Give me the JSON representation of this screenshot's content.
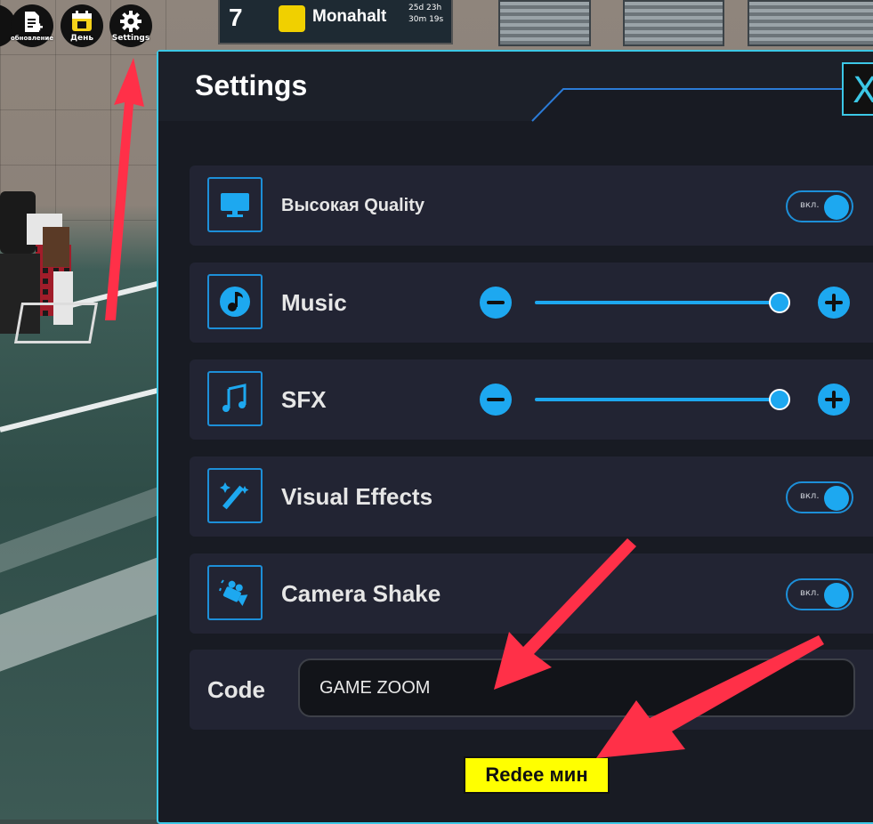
{
  "colors": {
    "accent": "#1da8f0",
    "panel_bg": "#181b23",
    "row_bg": "#222433",
    "redeem_bg": "#ffff00",
    "arrow": "#ff3048"
  },
  "top_buttons": [
    {
      "label": "обновление",
      "icon": "document-plus-icon"
    },
    {
      "label": "День",
      "icon": "calendar-icon"
    },
    {
      "label": "Settings",
      "icon": "gear-icon"
    }
  ],
  "leaderboard": {
    "rank": "7",
    "name": "Monahalt",
    "time_line1": "25d 23h",
    "time_line2": "30m 19s"
  },
  "settings": {
    "title": "Settings",
    "close_label": "X",
    "rows": [
      {
        "label": "Высокая Quality",
        "type": "toggle",
        "icon": "monitor-icon",
        "toggle_label": "вкл.",
        "on": true
      },
      {
        "label": "Music",
        "type": "slider",
        "icon": "music-disc-icon",
        "level": 1.0
      },
      {
        "label": "SFX",
        "type": "slider",
        "icon": "music-note-icon",
        "level": 1.0
      },
      {
        "label": "Visual Effects",
        "type": "toggle",
        "icon": "magic-wand-icon",
        "toggle_label": "вкл.",
        "on": true
      },
      {
        "label": "Camera Shake",
        "type": "toggle",
        "icon": "video-camera-icon",
        "toggle_label": "вкл.",
        "on": true
      }
    ],
    "code_label": "Code",
    "code_value": "GAME ZOOM",
    "redeem_label": "Redee мин"
  }
}
